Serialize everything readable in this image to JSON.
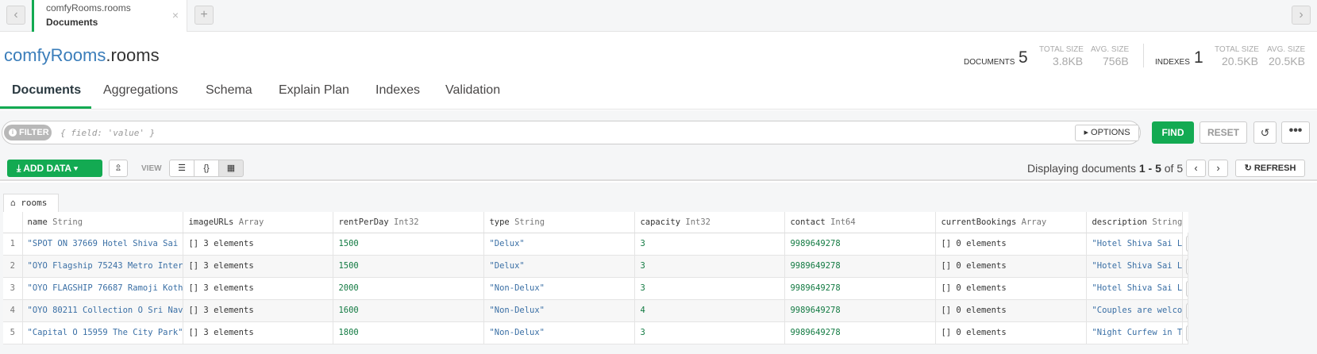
{
  "tab": {
    "namespace": "comfyRooms.rooms",
    "subtitle": "Documents",
    "close_glyph": "×",
    "new_glyph": "+"
  },
  "header": {
    "db": "comfyRooms",
    "coll": ".rooms"
  },
  "stats": {
    "documents_label": "DOCUMENTS",
    "documents_count": "5",
    "total_size_label": "TOTAL SIZE",
    "total_size": "3.8KB",
    "avg_size_label": "AVG. SIZE",
    "avg_size": "756B",
    "indexes_label": "INDEXES",
    "indexes_count": "1",
    "idx_total_label": "TOTAL SIZE",
    "idx_total": "20.5KB",
    "idx_avg_label": "AVG. SIZE",
    "idx_avg": "20.5KB"
  },
  "nav": [
    "Documents",
    "Aggregations",
    "Schema",
    "Explain Plan",
    "Indexes",
    "Validation"
  ],
  "filter": {
    "label": "FILTER",
    "placeholder": "{ field: 'value' }",
    "options": "OPTIONS",
    "find": "FIND",
    "reset": "RESET",
    "more": "•••"
  },
  "toolbar": {
    "add_data": "ADD DATA",
    "view": "VIEW",
    "display_prefix": "Displaying documents ",
    "display_range": "1 - 5",
    "display_of": " of 5",
    "refresh": "REFRESH"
  },
  "collection_tab": "rooms",
  "columns": [
    {
      "name": "name",
      "type": "String"
    },
    {
      "name": "imageURLs",
      "type": "Array"
    },
    {
      "name": "rentPerDay",
      "type": "Int32"
    },
    {
      "name": "type",
      "type": "String"
    },
    {
      "name": "capacity",
      "type": "Int32"
    },
    {
      "name": "contact",
      "type": "Int64"
    },
    {
      "name": "currentBookings",
      "type": "Array"
    },
    {
      "name": "description",
      "type": "String"
    }
  ],
  "rows": [
    [
      "1",
      "\"SPOT ON 37669 Hotel Shiva Sai",
      "[] 3 elements",
      "1500",
      "\"Delux\"",
      "3",
      "9989649278",
      "[] 0 elements",
      "\"Hotel Shiva Sai L"
    ],
    [
      "2",
      "\"OYO Flagship 75243 Metro Inter",
      "[] 3 elements",
      "1500",
      "\"Delux\"",
      "3",
      "9989649278",
      "[] 0 elements",
      "\"Hotel Shiva Sai L"
    ],
    [
      "3",
      "\"OYO FLAGSHIP 76687 Ramoji Koth",
      "[] 3 elements",
      "2000",
      "\"Non-Delux\"",
      "3",
      "9989649278",
      "[] 0 elements",
      "\"Hotel Shiva Sai L"
    ],
    [
      "4",
      "\"OYO 80211 Collection O Sri Nav",
      "[] 3 elements",
      "1600",
      "\"Non-Delux\"",
      "4",
      "9989649278",
      "[] 0 elements",
      "\"Couples are welco"
    ],
    [
      "5",
      "\"Capital O 15959 The City Park\"",
      "[] 3 elements",
      "1800",
      "\"Non-Delux\"",
      "3",
      "9989649278",
      "[] 0 elements",
      "\"Night Curfew in T"
    ]
  ]
}
